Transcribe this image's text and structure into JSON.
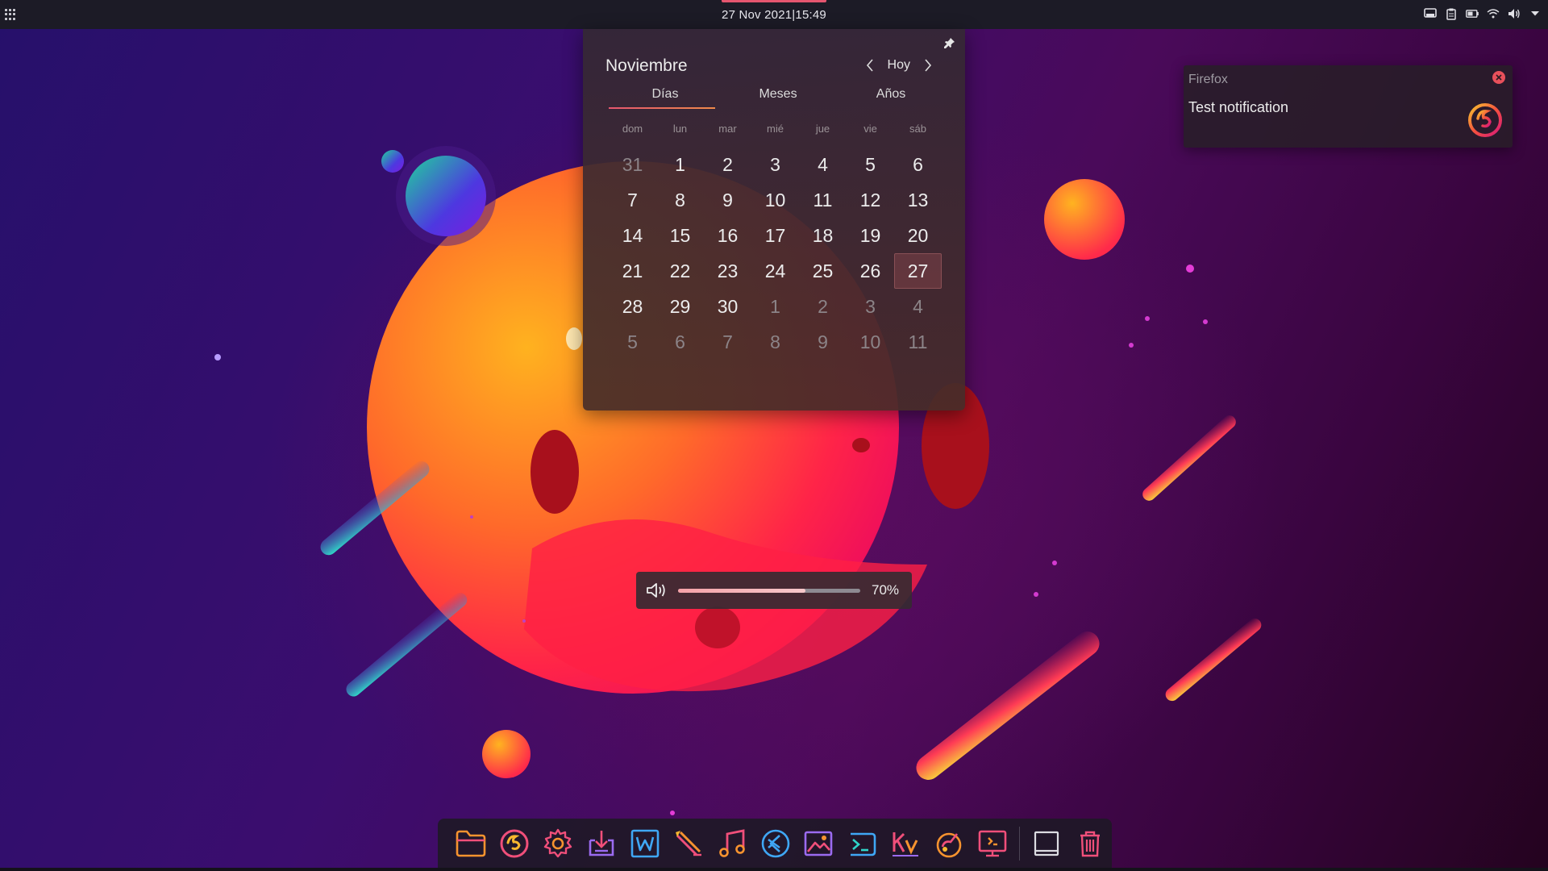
{
  "top_panel": {
    "clock_date": "27 Nov 2021",
    "clock_separator": "|",
    "clock_time": "15:49",
    "tray_icons": [
      "screen-icon",
      "clipboard-icon",
      "battery-icon",
      "wifi-icon",
      "volume-icon",
      "chevron-down-icon"
    ]
  },
  "calendar": {
    "month": "Noviembre",
    "today_button": "Hoy",
    "tabs": [
      "Días",
      "Meses",
      "Años"
    ],
    "active_tab": "Días",
    "weekdays": [
      "dom",
      "lun",
      "mar",
      "mié",
      "jue",
      "vie",
      "sáb"
    ],
    "days": [
      [
        "31",
        "1",
        "2",
        "3",
        "4",
        "5",
        "6"
      ],
      [
        "7",
        "8",
        "9",
        "10",
        "11",
        "12",
        "13"
      ],
      [
        "14",
        "15",
        "16",
        "17",
        "18",
        "19",
        "20"
      ],
      [
        "21",
        "22",
        "23",
        "24",
        "25",
        "26",
        "27"
      ],
      [
        "28",
        "29",
        "30",
        "1",
        "2",
        "3",
        "4"
      ],
      [
        "5",
        "6",
        "7",
        "8",
        "9",
        "10",
        "11"
      ]
    ],
    "today": "27"
  },
  "notification": {
    "app_name": "Firefox",
    "body": "Test notification",
    "icon": "firefox-icon"
  },
  "volume_osd": {
    "level": 70,
    "label": "70%",
    "icon": "speaker-icon"
  },
  "dock": {
    "items": [
      {
        "name": "files-icon",
        "running": true
      },
      {
        "name": "firefox-icon",
        "running": true
      },
      {
        "name": "settings-icon",
        "running": true
      },
      {
        "name": "software-install-icon",
        "running": false
      },
      {
        "name": "writer-icon",
        "running": false
      },
      {
        "name": "draw-icon",
        "running": false
      },
      {
        "name": "music-icon",
        "running": false
      },
      {
        "name": "vscode-icon",
        "running": true
      },
      {
        "name": "image-viewer-icon",
        "running": false
      },
      {
        "name": "terminal-icon",
        "running": true
      },
      {
        "name": "kvantum-icon",
        "running": true
      },
      {
        "name": "theme-tweak-icon",
        "running": false
      },
      {
        "name": "system-monitor-icon",
        "running": true
      }
    ],
    "extra": [
      "show-desktop-icon",
      "trash-icon"
    ],
    "colors": {
      "pink": "#f04f7a",
      "orange": "#f7932f",
      "purple": "#9b6bf0",
      "blue": "#3fa7f5"
    }
  }
}
